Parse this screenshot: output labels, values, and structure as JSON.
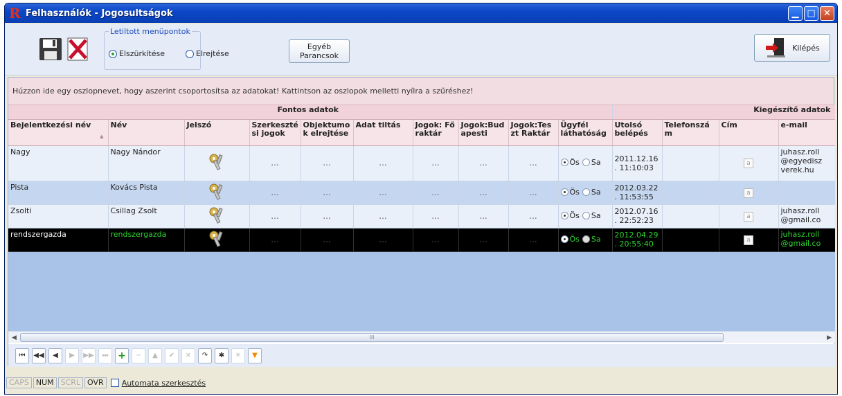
{
  "window": {
    "title": "Felhasználók - Jogosultságok"
  },
  "toolbar": {
    "menu_group_title": "Letiltott menüpontok",
    "radio_grey": "Elszürkítése",
    "radio_hide": "Elrejtése",
    "radio_selected": "Elszürkítése",
    "other_cmd_line1": "Egyéb",
    "other_cmd_line2": "Parancsok",
    "exit_label": "Kilépés"
  },
  "groupby_hint": "Húzzon ide egy oszlopnevet, hogy aszerint csoportosítsa az adatokat! Kattintson az oszlopok melletti nyílra a szűréshez!",
  "grid": {
    "bands": {
      "main": "Fontos adatok",
      "extra": "Kiegészítő adatok"
    },
    "columns": {
      "login": "Bejelentkezési név",
      "name": "Név",
      "password": "Jelszó",
      "edit_rights": "Szerkeszté si jogok",
      "hide_objects": "Objektumo k elrejtése",
      "data_block": "Adat tiltás",
      "rights_main": "Jogok: Fő raktár",
      "rights_bp": "Jogok:Bud apesti",
      "rights_test": "Jogok:Tes zt Raktár",
      "client_vis": "Ügyfél láthatóság",
      "last_login": "Utolsó belépés",
      "phone": "Telefonszá m",
      "address": "Cím",
      "email": "e-mail"
    },
    "dots": "...",
    "vis_opt1": "Ös",
    "vis_opt2": "Sa",
    "cim_glyph": "a",
    "rows": [
      {
        "login": "Nagy",
        "name": "Nagy Nándor",
        "last_login_1": "2011.12.16",
        "last_login_2": ". 11:10:03",
        "email": "juhasz.roll @egyedisz verek.hu"
      },
      {
        "login": "Pista",
        "name": "Kovács Pista",
        "last_login_1": "2012.03.22",
        "last_login_2": ". 11:53:55",
        "email": ""
      },
      {
        "login": "Zsolti",
        "name": "Csillag Zsolt",
        "last_login_1": "2012.07.16",
        "last_login_2": ". 22:52:23",
        "email": "juhasz.roll @gmail.co"
      },
      {
        "login": "rendszergazda",
        "name": "rendszergazda",
        "last_login_1": "2012.04.29",
        "last_login_2": ". 20:55:40",
        "email": "juhasz.roll @gmail.co"
      }
    ]
  },
  "scroll": {
    "grip": "III"
  },
  "status": {
    "caps": "CAPS",
    "num": "NUM",
    "scrl": "SCRL",
    "ovr": "OVR",
    "auto_edit": "Automata szerkesztés"
  },
  "colors": {
    "title_blue": "#0b47c7",
    "row_selected_bg": "#000000",
    "row_selected_green": "#2fd52f"
  }
}
